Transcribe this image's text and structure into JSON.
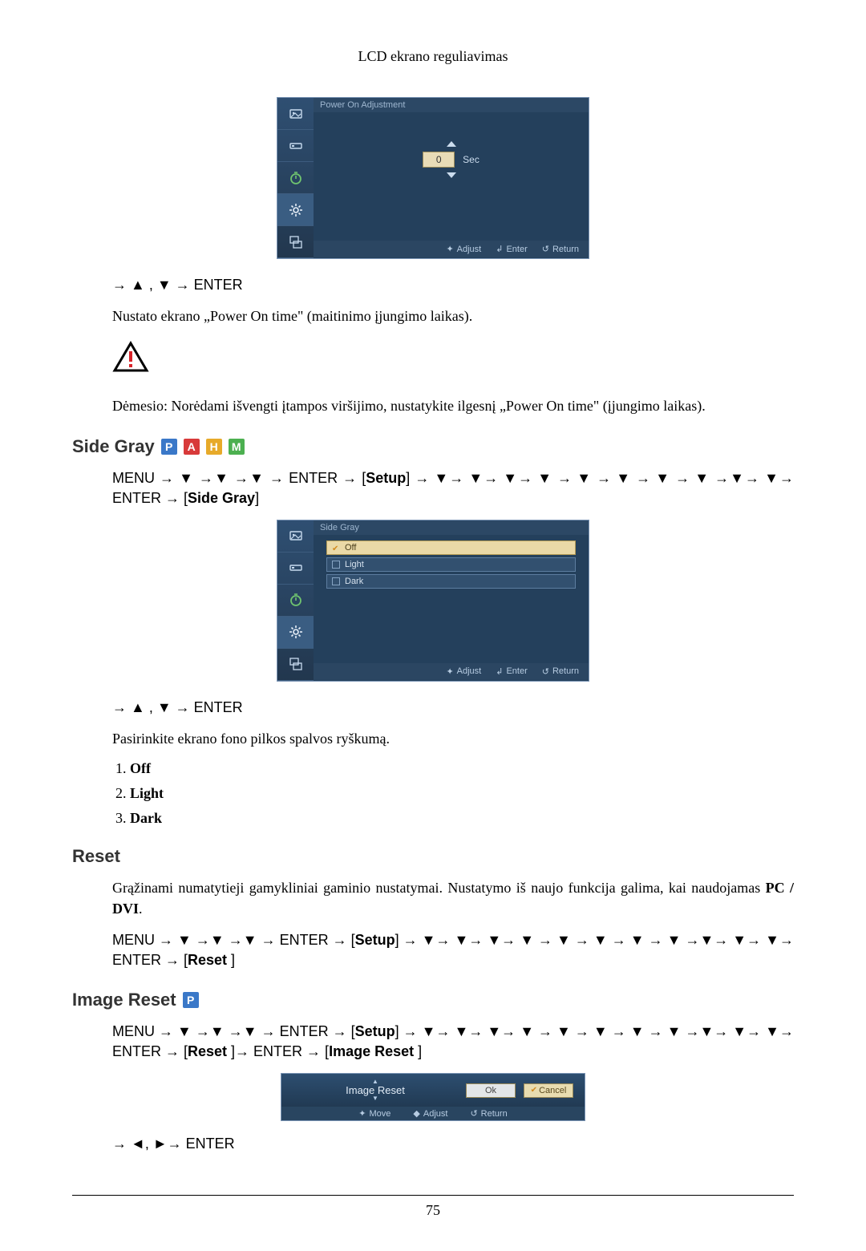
{
  "header": {
    "title": "LCD ekrano reguliavimas"
  },
  "footer": {
    "page": "75"
  },
  "osd_common": {
    "footer_adjust": "Adjust",
    "footer_enter": "Enter",
    "footer_return": "Return",
    "footer_move": "Move"
  },
  "power_on_adj": {
    "title": "Power On Adjustment",
    "value": "0",
    "unit": "Sec",
    "nav_line": "→ ▲ , ▼ → ENTER",
    "desc": "Nustato ekrano „Power On time\" (maitinimo įjungimo laikas).",
    "warn": "Dėmesio: Norėdami išvengti įtampos viršijimo, nustatykite ilgesnį „Power On time\" (įjungimo laikas)."
  },
  "side_gray": {
    "heading": "Side Gray",
    "menu_line_prefix": "MENU → ▼ →▼ →▼ → ENTER → [",
    "menu_line_setup": "Setup",
    "menu_line_mid": "] → ▼→ ▼→ ▼→ ▼ → ▼ → ▼ → ▼ → ▼ →▼→ ▼→ ENTER → [",
    "menu_line_target": "Side Gray",
    "menu_line_suffix": "]",
    "osd_title": "Side Gray",
    "options": [
      "Off",
      "Light",
      "Dark"
    ],
    "nav_line": "→ ▲ , ▼ → ENTER",
    "desc": "Pasirinkite ekrano fono pilkos spalvos ryškumą.",
    "list": {
      "1": "Off",
      "2": "Light",
      "3": "Dark"
    }
  },
  "reset": {
    "heading": "Reset",
    "desc_prefix": "Grąžinami numatytieji gamykliniai gaminio nustatymai. Nustatymo iš naujo funkcija galima, kai naudojamas ",
    "desc_bold": "PC / DVI",
    "desc_suffix": ".",
    "menu_line_prefix": "MENU → ▼ →▼ →▼ → ENTER → [",
    "menu_line_setup": "Setup",
    "menu_line_mid": "] → ▼→ ▼→ ▼→ ▼ → ▼ → ▼ → ▼ → ▼ →▼→ ▼→ ▼→ ENTER → [",
    "menu_line_target": "Reset ",
    "menu_line_suffix": "]"
  },
  "image_reset": {
    "heading": "Image Reset",
    "menu_line_prefix": "MENU → ▼ →▼ →▼ → ENTER → [",
    "menu_line_setup": "Setup",
    "menu_line_mid": "] → ▼→ ▼→ ▼→ ▼ → ▼ → ▼ → ▼ → ▼ →▼→ ▼→ ▼→ ENTER → [",
    "menu_line_r1": "Reset ",
    "menu_line_r2": "]→ ENTER → [",
    "menu_line_r3": "Image Reset ",
    "menu_line_suffix": "]",
    "dialog_title": "Image Reset",
    "btn_ok": "Ok",
    "btn_cancel": "Cancel",
    "nav_line": "→ ◄, ►→ ENTER"
  }
}
